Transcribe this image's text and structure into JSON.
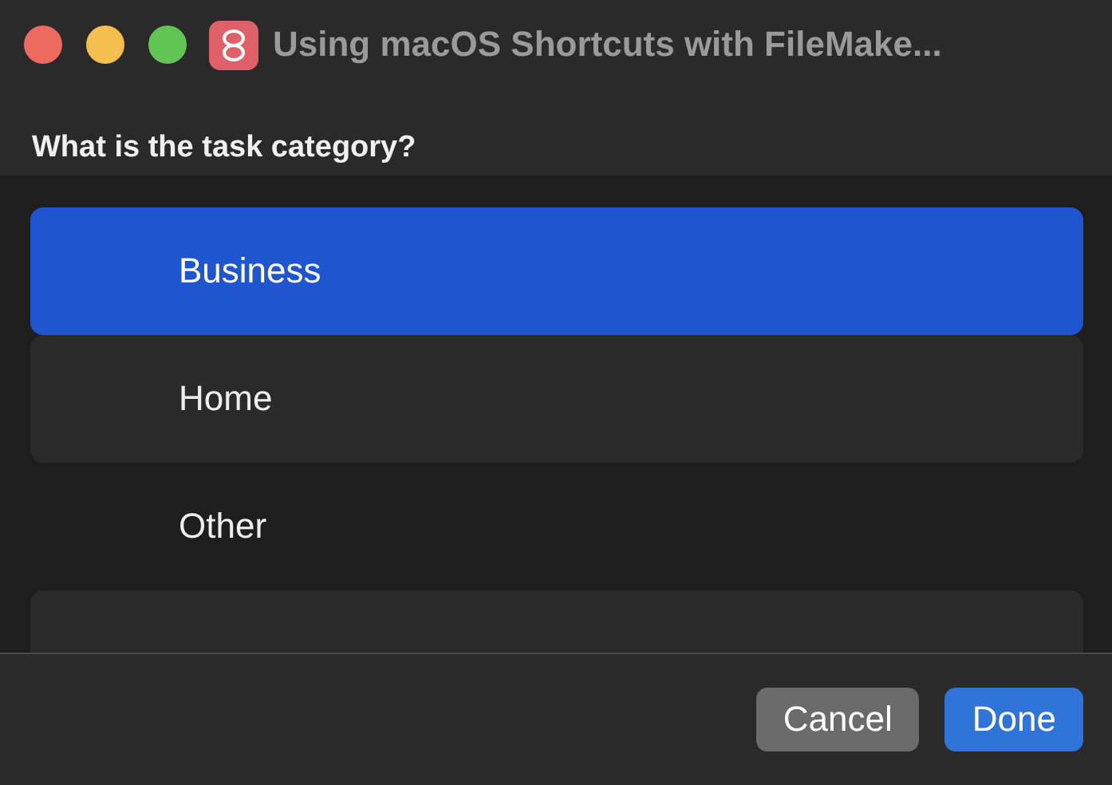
{
  "window": {
    "title": "Using macOS Shortcuts with FileMake..."
  },
  "prompt": "What is the task category?",
  "options": [
    {
      "label": "Business",
      "selected": true
    },
    {
      "label": "Home",
      "selected": false
    },
    {
      "label": "Other",
      "selected": false
    }
  ],
  "buttons": [
    {
      "label": "Cancel",
      "kind": "secondary"
    },
    {
      "label": "Done",
      "kind": "primary"
    }
  ]
}
